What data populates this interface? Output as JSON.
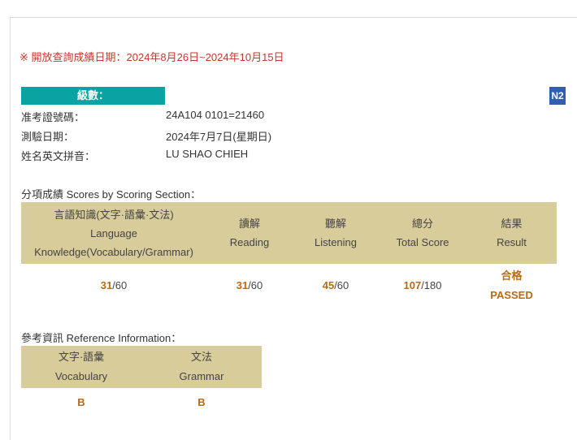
{
  "notice": "※ 開放查詢成績日期：2024年8月26日~2024年10月15日",
  "level": {
    "label": "級數：",
    "value": "N2"
  },
  "info": [
    {
      "key": "准考證號碼：",
      "value": "24A104 0101=21460"
    },
    {
      "key": "測驗日期：",
      "value": "2024年7月7日(星期日)"
    },
    {
      "key": "姓名英文拼音：",
      "value": "LU SHAO CHIEH"
    }
  ],
  "scores_title": "分項成績 Scores by Scoring Section：",
  "score_headers": {
    "knowledge": {
      "zh": "言語知識(文字·語彙·文法)",
      "en1": "Language",
      "en2": "Knowledge(Vocabulary/Grammar)"
    },
    "reading": {
      "zh": "讀解",
      "en": "Reading"
    },
    "listening": {
      "zh": "聽解",
      "en": "Listening"
    },
    "total": {
      "zh": "總分",
      "en": "Total Score"
    },
    "result": {
      "zh": "結果",
      "en": "Result"
    }
  },
  "scores": {
    "knowledge": {
      "score": "31",
      "max": "/60"
    },
    "reading": {
      "score": "31",
      "max": "/60"
    },
    "listening": {
      "score": "45",
      "max": "/60"
    },
    "total": {
      "score": "107",
      "max": "/180"
    },
    "result": {
      "zh": "合格",
      "en": "PASSED"
    }
  },
  "reference_title": "參考資訊 Reference Information：",
  "reference": {
    "vocabulary": {
      "zh": "文字·語彙",
      "en": "Vocabulary",
      "grade": "B"
    },
    "grammar": {
      "zh": "文法",
      "en": "Grammar",
      "grade": "B"
    }
  },
  "colors": {
    "accent_teal": "#0aa3a3",
    "badge_blue": "#2f5fae",
    "header_tan": "#d8cc9a",
    "score_orange": "#b86b12",
    "notice_red": "#c0392b"
  }
}
